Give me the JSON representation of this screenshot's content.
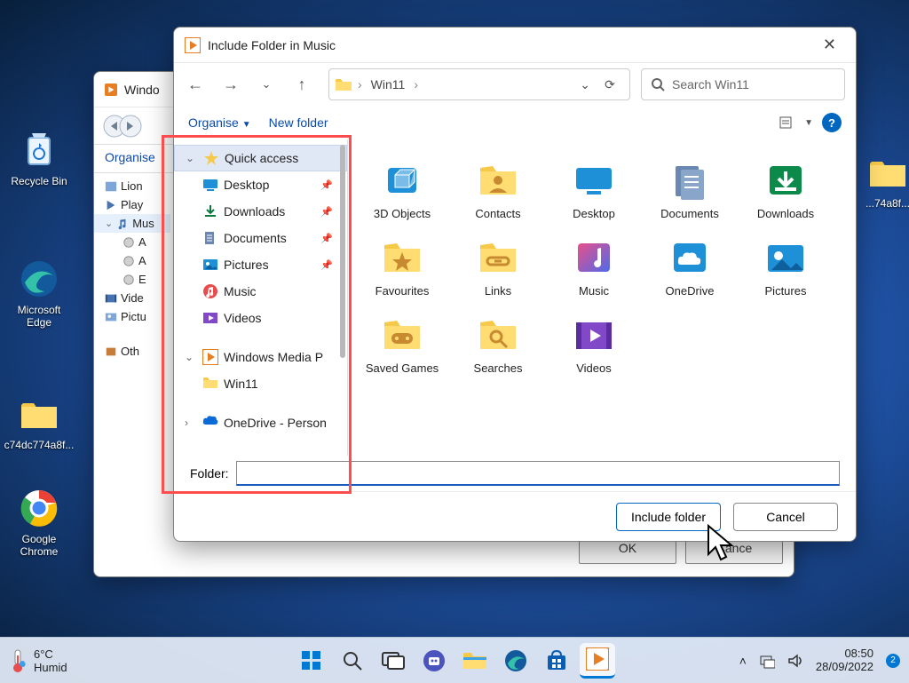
{
  "desktop": {
    "recycle": "Recycle Bin",
    "edge": "Microsoft Edge",
    "folder1": "c74dc774a8f...",
    "folder2": "...74a8f...",
    "chrome": "Google Chrome"
  },
  "bg_window": {
    "title": "Windo",
    "organise": "Organise",
    "tree": [
      "Lion",
      "Play",
      "Mus",
      "A",
      "A",
      "E",
      "Vide",
      "Pictu",
      "Oth"
    ],
    "ok": "OK",
    "cancel": "Cance"
  },
  "dlg": {
    "title": "Include Folder in Music",
    "breadcrumb": "Win11",
    "search_placeholder": "Search Win11",
    "organise": "Organise",
    "newfolder": "New folder",
    "nav": {
      "quick": "Quick access",
      "desktop": "Desktop",
      "downloads": "Downloads",
      "documents": "Documents",
      "pictures": "Pictures",
      "music": "Music",
      "videos": "Videos",
      "wmp": "Windows Media P",
      "win11": "Win11",
      "onedrive": "OneDrive - Person"
    },
    "tiles": [
      "3D Objects",
      "Contacts",
      "Desktop",
      "Documents",
      "Downloads",
      "Favourites",
      "Links",
      "Music",
      "OneDrive",
      "Pictures",
      "Saved Games",
      "Searches",
      "Videos"
    ],
    "folder_label": "Folder:",
    "folder_value": "",
    "include": "Include folder",
    "cancel": "Cancel"
  },
  "taskbar": {
    "temp": "6°C",
    "weather": "Humid",
    "time": "08:50",
    "date": "28/09/2022",
    "notif": "2"
  }
}
